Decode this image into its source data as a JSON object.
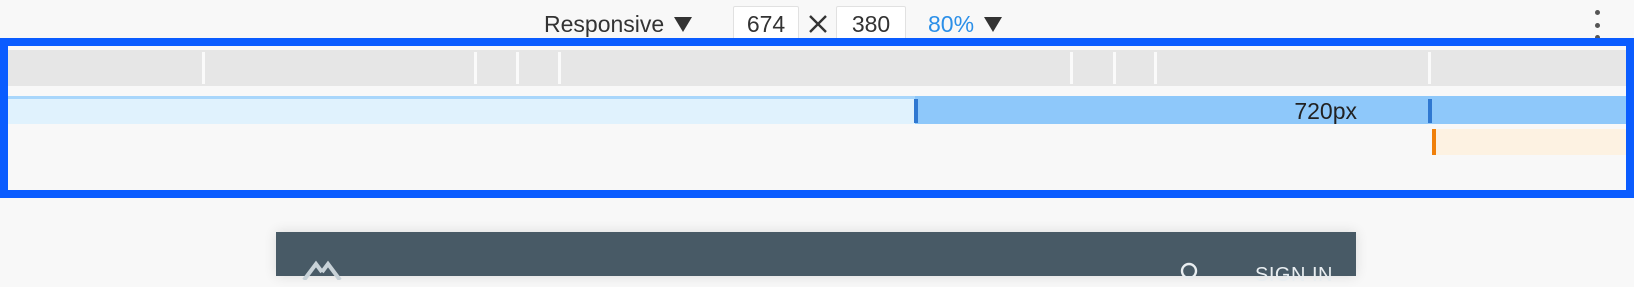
{
  "toolbar": {
    "device": "Responsive",
    "width": "674",
    "height": "380",
    "zoom": "80%",
    "dropdown_icon": "triangle-down-icon",
    "times_icon": "times-icon",
    "more_icon": "vertical-ellipsis-icon"
  },
  "media_queries": {
    "min_width_label": "720px",
    "colors": {
      "outline": "#0a5cff",
      "min_bar": "#8ec8fa",
      "min_bar_light": "#e0f2fd",
      "max_bar": "#fdf2e2",
      "max_marker": "#f0800a"
    }
  },
  "page_preview": {
    "header_color": "#485a66",
    "sign_in": "SIGN IN"
  }
}
